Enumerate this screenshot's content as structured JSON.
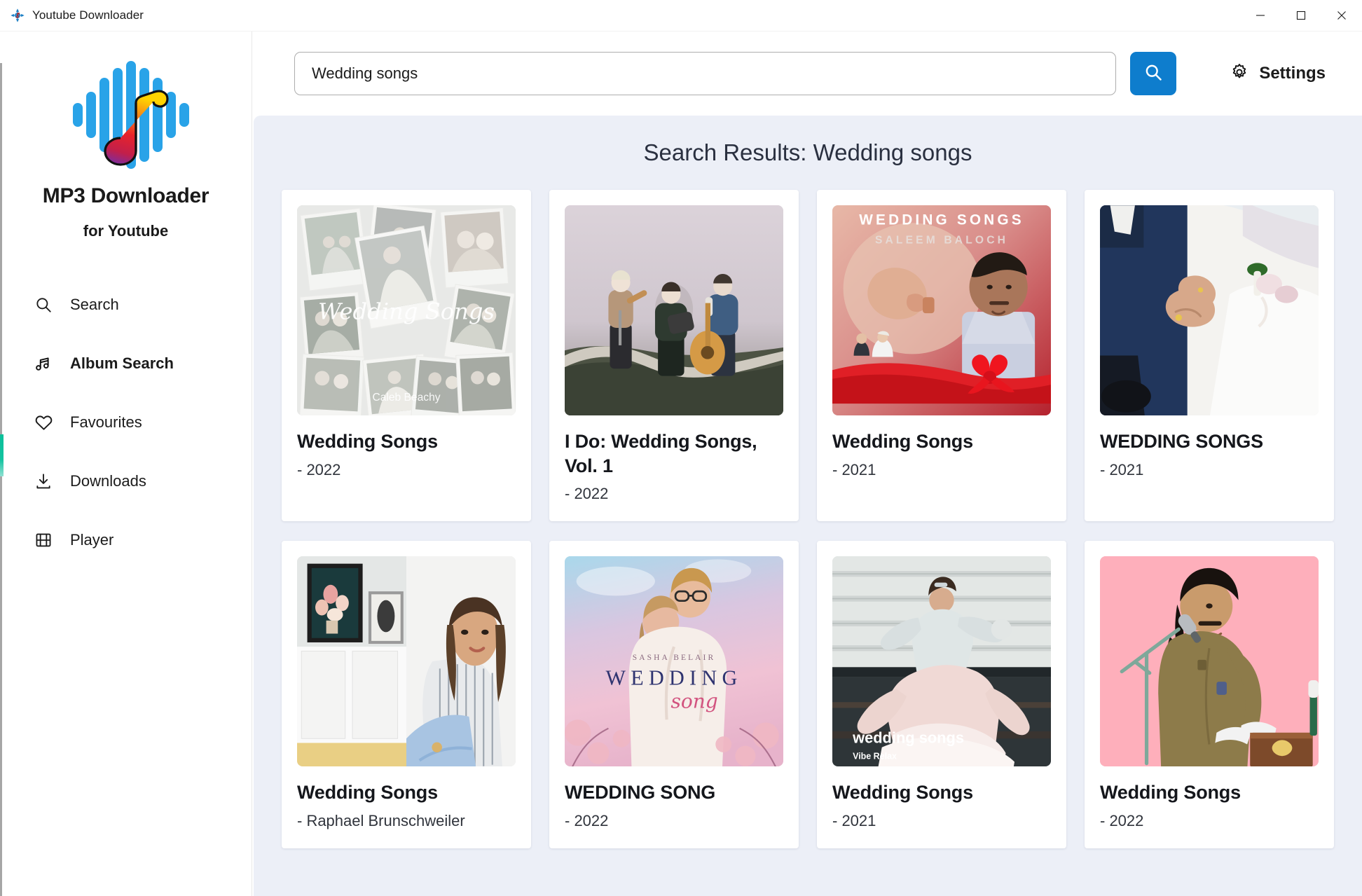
{
  "window": {
    "title": "Youtube Downloader",
    "app_icon": "app-logo-icon",
    "controls": {
      "minimize": "minimize-icon",
      "maximize": "maximize-icon",
      "close": "close-icon"
    }
  },
  "sidebar": {
    "logo_icon": "mp3-waveform-note-logo",
    "brand": "MP3 Downloader",
    "brand_sub": "for Youtube",
    "items": [
      {
        "label": "Search",
        "icon": "search-icon",
        "active": false
      },
      {
        "label": "Album Search",
        "icon": "music-note-icon",
        "active": true
      },
      {
        "label": "Favourites",
        "icon": "heart-icon",
        "active": false
      },
      {
        "label": "Downloads",
        "icon": "download-icon",
        "active": false
      },
      {
        "label": "Player",
        "icon": "film-icon",
        "active": false
      }
    ]
  },
  "toolbar": {
    "search_value": "Wedding songs",
    "search_placeholder": "Search",
    "search_button_icon": "search-icon",
    "settings_label": "Settings",
    "settings_icon": "gear-icon"
  },
  "main": {
    "results_title": "Search Results: Wedding songs"
  },
  "colors": {
    "accent_blue": "#0e7dcd",
    "content_bg": "#eceff7",
    "card_bg": "#ffffff",
    "text_primary": "#15171c",
    "edge_accent": "#13c3a0"
  },
  "results": [
    {
      "title": "Wedding Songs",
      "subtitle": "- 2022",
      "art": {
        "kind": "polaroid-collage",
        "overlay_title": "Wedding Songs",
        "overlay_artist": "Caleb Beachy"
      }
    },
    {
      "title": "I Do: Wedding Songs, Vol. 1",
      "subtitle": "- 2022",
      "art": {
        "kind": "foggy-band-photo",
        "overlay_title": "",
        "overlay_artist": ""
      }
    },
    {
      "title": "Wedding Songs",
      "subtitle": "- 2021",
      "art": {
        "kind": "red-ribbon-portrait",
        "overlay_title": "WEDDING SONGS",
        "overlay_artist": "SALEEM BALOCH"
      }
    },
    {
      "title": "WEDDING SONGS",
      "subtitle": "- 2021",
      "art": {
        "kind": "holding-hands-photo",
        "overlay_title": "",
        "overlay_artist": ""
      }
    },
    {
      "title": "Wedding Songs",
      "subtitle": "- Raphael Brunschweiler",
      "art": {
        "kind": "woman-with-framed-art",
        "overlay_title": "",
        "overlay_artist": ""
      }
    },
    {
      "title": "WEDDING SONG",
      "subtitle": "- 2022",
      "art": {
        "kind": "pastel-couple-blanket",
        "overlay_title": "WEDDING",
        "overlay_artist": "SASHA BELAIR",
        "overlay_script": "song"
      }
    },
    {
      "title": "Wedding Songs",
      "subtitle": "- 2021",
      "art": {
        "kind": "twirling-bride",
        "overlay_title": "wedding songs",
        "overlay_artist": "Vibe Relax"
      }
    },
    {
      "title": "Wedding Songs",
      "subtitle": "- 2022",
      "art": {
        "kind": "pink-bg-singer",
        "overlay_title": "",
        "overlay_artist": ""
      }
    }
  ]
}
